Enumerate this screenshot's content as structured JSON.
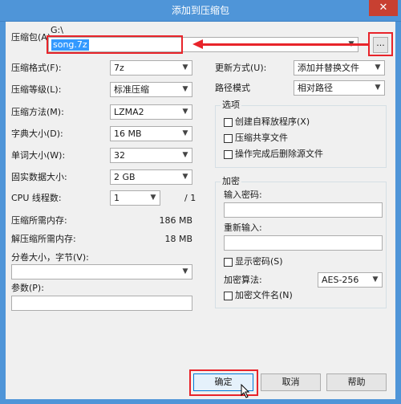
{
  "window": {
    "title": "添加到压缩包",
    "close_label": "✕"
  },
  "archive": {
    "label": "压缩包(A)",
    "path_prefix": "G:\\",
    "filename": "song.7z",
    "browse_label": "..."
  },
  "left": {
    "format_label": "压缩格式(F):",
    "format_value": "7z",
    "level_label": "压缩等级(L):",
    "level_value": "标准压缩",
    "method_label": "压缩方法(M):",
    "method_value": "LZMA2",
    "dict_label": "字典大小(D):",
    "dict_value": "16 MB",
    "word_label": "单词大小(W):",
    "word_value": "32",
    "solid_label": "固实数据大小:",
    "solid_value": "2 GB",
    "threads_label": "CPU 线程数:",
    "threads_value": "1",
    "threads_total": "/ 1",
    "mem_comp_label": "压缩所需内存:",
    "mem_comp_value": "186 MB",
    "mem_decomp_label": "解压缩所需内存:",
    "mem_decomp_value": "18 MB",
    "volume_label": "分卷大小，字节(V):",
    "params_label": "参数(P):"
  },
  "right": {
    "update_label": "更新方式(U):",
    "update_value": "添加并替换文件",
    "pathmode_label": "路径模式",
    "pathmode_value": "相对路径",
    "options_title": "选项",
    "opt_sfx": "创建自释放程序(X)",
    "opt_shared": "压缩共享文件",
    "opt_delete": "操作完成后删除源文件",
    "enc_title": "加密",
    "enc_pwd_label": "输入密码:",
    "enc_repeat_label": "重新输入:",
    "enc_show_label": "显示密码(S)",
    "enc_method_label": "加密算法:",
    "enc_method_value": "AES-256",
    "enc_names_label": "加密文件名(N)"
  },
  "buttons": {
    "ok": "确定",
    "cancel": "取消",
    "help": "帮助"
  },
  "colors": {
    "titlebar": "#4f95d8",
    "close": "#c84031",
    "highlight": "#e8242a",
    "selection": "#3399ff"
  }
}
